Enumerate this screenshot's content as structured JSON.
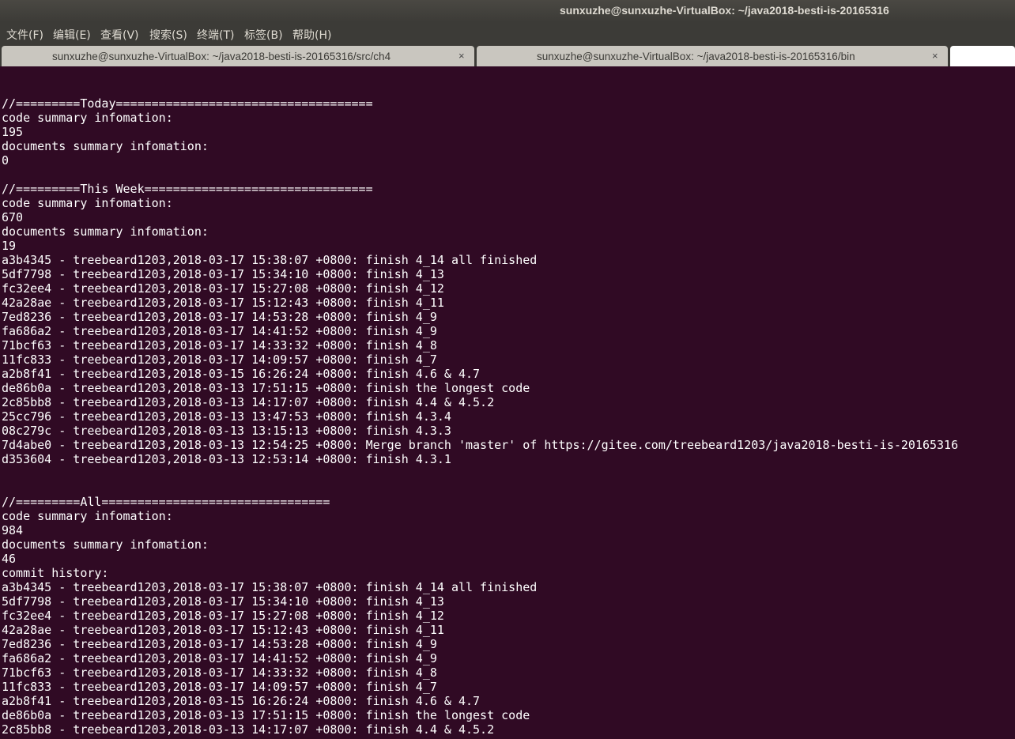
{
  "window": {
    "title": "sunxuzhe@sunxuzhe-VirtualBox: ~/java2018-besti-is-20165316"
  },
  "menu": [
    "文件(F)",
    "编辑(E)",
    "查看(V)",
    "搜索(S)",
    "终端(T)",
    "标签(B)",
    "帮助(H)"
  ],
  "tabs": [
    {
      "label": "sunxuzhe@sunxuzhe-VirtualBox: ~/java2018-besti-is-20165316/src/ch4",
      "close": "×"
    },
    {
      "label": "sunxuzhe@sunxuzhe-VirtualBox: ~/java2018-besti-is-20165316/bin",
      "close": "×"
    },
    {
      "label": "",
      "close": ""
    }
  ],
  "terminal": {
    "lines": [
      "",
      "",
      "//=========Today====================================",
      "code summary infomation:",
      "195",
      "documents summary infomation:",
      "0",
      "",
      "//=========This Week================================",
      "code summary infomation:",
      "670",
      "documents summary infomation:",
      "19",
      "a3b4345 - treebeard1203,2018-03-17 15:38:07 +0800: finish 4_14 all finished",
      "5df7798 - treebeard1203,2018-03-17 15:34:10 +0800: finish 4_13",
      "fc32ee4 - treebeard1203,2018-03-17 15:27:08 +0800: finish 4_12",
      "42a28ae - treebeard1203,2018-03-17 15:12:43 +0800: finish 4_11",
      "7ed8236 - treebeard1203,2018-03-17 14:53:28 +0800: finish 4_9",
      "fa686a2 - treebeard1203,2018-03-17 14:41:52 +0800: finish 4_9",
      "71bcf63 - treebeard1203,2018-03-17 14:33:32 +0800: finish 4_8",
      "11fc833 - treebeard1203,2018-03-17 14:09:57 +0800: finish 4_7",
      "a2b8f41 - treebeard1203,2018-03-15 16:26:24 +0800: finish 4.6 & 4.7",
      "de86b0a - treebeard1203,2018-03-13 17:51:15 +0800: finish the longest code",
      "2c85bb8 - treebeard1203,2018-03-13 14:17:07 +0800: finish 4.4 & 4.5.2",
      "25cc796 - treebeard1203,2018-03-13 13:47:53 +0800: finish 4.3.4",
      "08c279c - treebeard1203,2018-03-13 13:15:13 +0800: finish 4.3.3",
      "7d4abe0 - treebeard1203,2018-03-13 12:54:25 +0800: Merge branch 'master' of https://gitee.com/treebeard1203/java2018-besti-is-20165316",
      "d353604 - treebeard1203,2018-03-13 12:53:14 +0800: finish 4.3.1",
      "",
      "",
      "//=========All================================",
      "code summary infomation:",
      "984",
      "documents summary infomation:",
      "46",
      "commit history:",
      "a3b4345 - treebeard1203,2018-03-17 15:38:07 +0800: finish 4_14 all finished",
      "5df7798 - treebeard1203,2018-03-17 15:34:10 +0800: finish 4_13",
      "fc32ee4 - treebeard1203,2018-03-17 15:27:08 +0800: finish 4_12",
      "42a28ae - treebeard1203,2018-03-17 15:12:43 +0800: finish 4_11",
      "7ed8236 - treebeard1203,2018-03-17 14:53:28 +0800: finish 4_9",
      "fa686a2 - treebeard1203,2018-03-17 14:41:52 +0800: finish 4_9",
      "71bcf63 - treebeard1203,2018-03-17 14:33:32 +0800: finish 4_8",
      "11fc833 - treebeard1203,2018-03-17 14:09:57 +0800: finish 4_7",
      "a2b8f41 - treebeard1203,2018-03-15 16:26:24 +0800: finish 4.6 & 4.7",
      "de86b0a - treebeard1203,2018-03-13 17:51:15 +0800: finish the longest code",
      "2c85bb8 - treebeard1203,2018-03-13 14:17:07 +0800: finish 4.4 & 4.5.2"
    ]
  },
  "colors": {
    "terminal_background": "#300a24",
    "terminal_text": "#ffffff",
    "chrome": "#3c3b37",
    "inactive_tab": "#c9c6bf",
    "active_tab": "#ffffff"
  }
}
